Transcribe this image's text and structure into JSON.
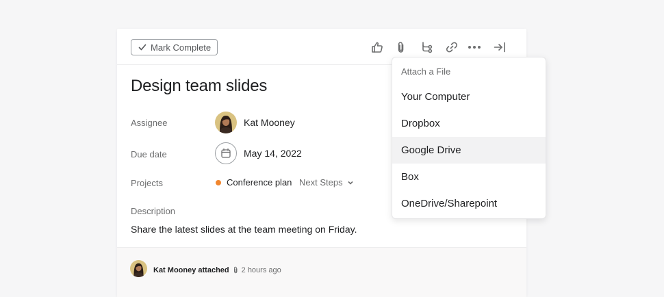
{
  "toolbar": {
    "mark_complete_label": "Mark Complete",
    "icons": [
      "thumbs-up-icon",
      "paperclip-icon",
      "subtask-icon",
      "link-icon",
      "more-icon",
      "close-panel-icon"
    ]
  },
  "task": {
    "title": "Design team slides",
    "assignee_label": "Assignee",
    "assignee_name": "Kat Mooney",
    "due_label": "Due date",
    "due_value": "May 14, 2022",
    "projects_label": "Projects",
    "project_name": "Conference plan",
    "project_color": "#f1862e",
    "project_section": "Next Steps",
    "description_label": "Description",
    "description_text": "Share the latest slides at the team meeting on Friday."
  },
  "activity": {
    "actor": "Kat Mooney attached",
    "time": "2 hours ago"
  },
  "attach_menu": {
    "header": "Attach a File",
    "items": [
      "Your Computer",
      "Dropbox",
      "Google Drive",
      "Box",
      "OneDrive/Sharepoint"
    ],
    "highlighted": "Google Drive"
  }
}
